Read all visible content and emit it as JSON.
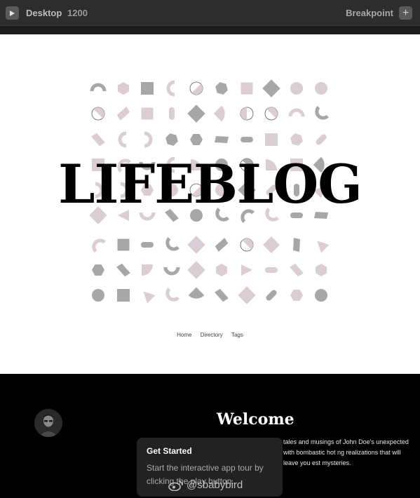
{
  "toolbar": {
    "device_label": "Desktop",
    "width_value": "1200",
    "breakpoint_label": "Breakpoint",
    "add_symbol": "+"
  },
  "site": {
    "logo": "LIFEBLOG",
    "nav": [
      "Home",
      "Directory",
      "Tags"
    ],
    "welcome_title": "Welcome",
    "welcome_text": "tales and musings of John Doe's unexpected with bombastic hot ng realizations that will leave you est mysteries."
  },
  "tour": {
    "title": "Get Started",
    "body": "Start the interactive app tour by clicking the play button."
  },
  "watermark": "@sbabybird",
  "colors": {
    "toolbar_bg": "#2d2d2d",
    "shape_pink": "#dacdd3",
    "shape_gray": "#a7a7a7",
    "dark_bg": "#000000"
  }
}
